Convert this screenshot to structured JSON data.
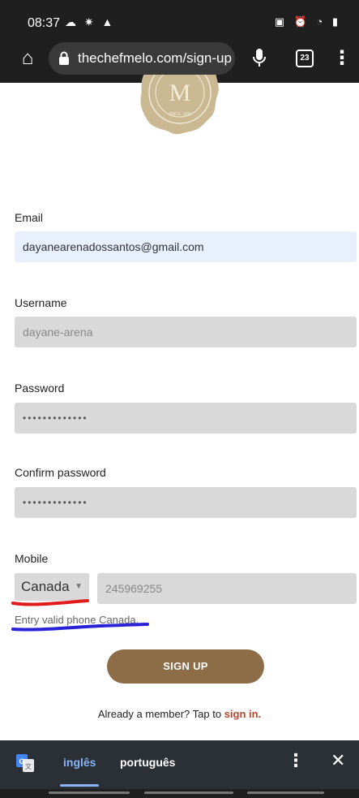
{
  "status_bar": {
    "time": "08:37",
    "left_icons": "☁ ✷ ▲",
    "right_icons": "▣ ⏰ ◔ ▮"
  },
  "browser": {
    "url": "thechefmelo.com/sign-up-",
    "tab_count": "23"
  },
  "logo": {
    "letter": "M",
    "caption": "SINCE 1996"
  },
  "form": {
    "email_label": "Email",
    "email_value": "dayanearenadossantos@gmail.com",
    "username_label": "Username",
    "username_value": "dayane-arena",
    "password_label": "Password",
    "password_value": "•••••••••••••",
    "confirm_label": "Confirm password",
    "confirm_value": "•••••••••••••",
    "mobile_label": "Mobile",
    "country_value": "Canada",
    "phone_value": "245969255",
    "phone_error": "Entry valid phone Canada.",
    "signup_label": "SIGN UP",
    "already_text": "Already a member? Tap to ",
    "signin_link": "sign in."
  },
  "translate_bar": {
    "lang_active": "inglês",
    "lang_other": "português"
  },
  "colors": {
    "accent_button": "#8c6d47",
    "link": "#b5472d",
    "translate_active": "#8ab4f8"
  }
}
